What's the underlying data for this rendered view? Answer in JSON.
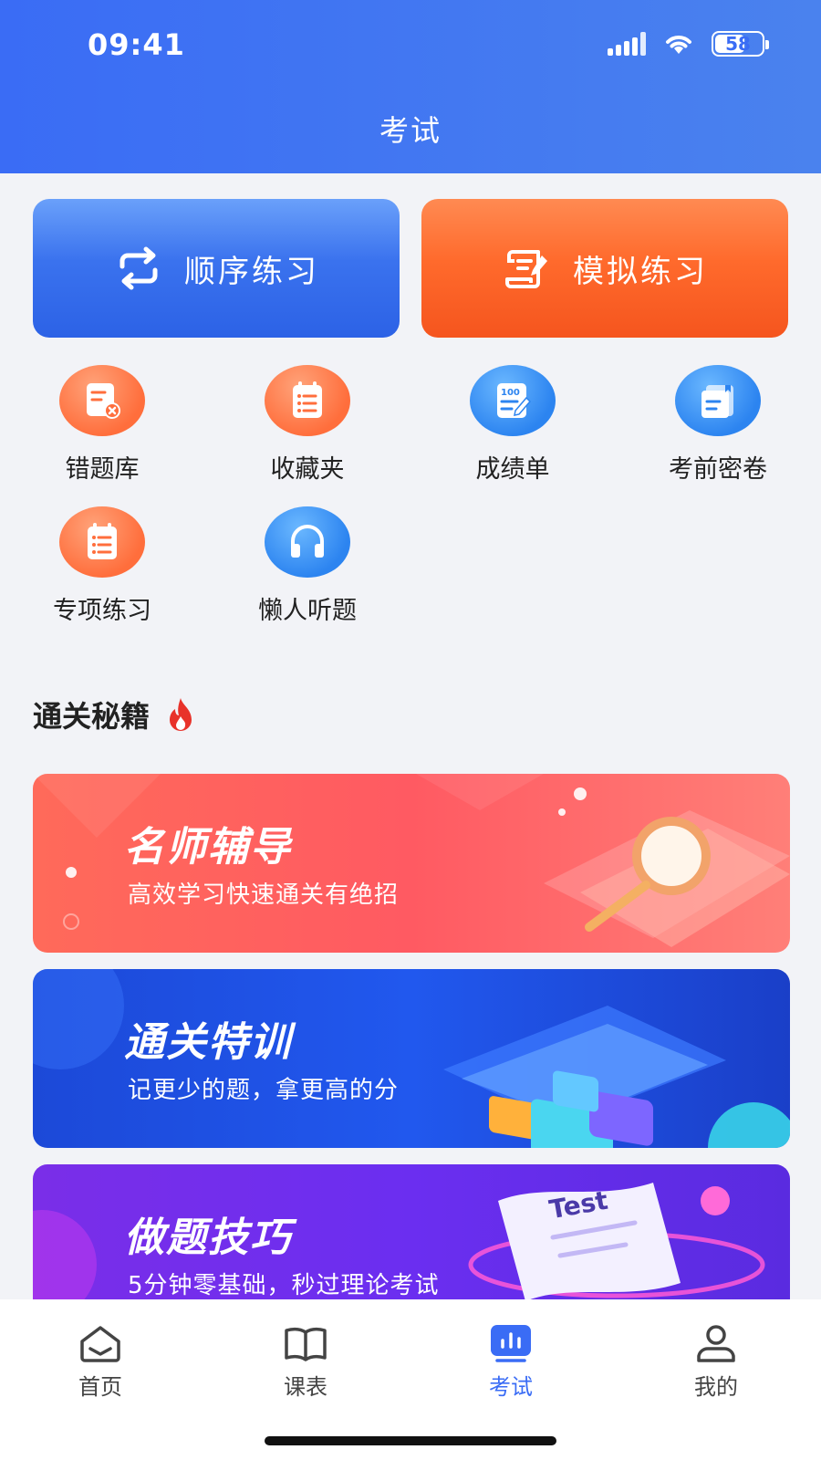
{
  "status": {
    "time": "09:41",
    "battery": "58"
  },
  "header": {
    "title": "考试"
  },
  "actions": {
    "sequential_label": "顺序练习",
    "mock_label": "模拟练习"
  },
  "grid": {
    "items": [
      {
        "label": "错题库",
        "icon": "wrong-questions-icon",
        "color": "#ff6e3c"
      },
      {
        "label": "收藏夹",
        "icon": "favorites-icon",
        "color": "#ff6e3c"
      },
      {
        "label": "成绩单",
        "icon": "score-report-icon",
        "color": "#2c84f0"
      },
      {
        "label": "考前密卷",
        "icon": "secret-paper-icon",
        "color": "#2c84f0"
      },
      {
        "label": "专项练习",
        "icon": "special-practice-icon",
        "color": "#ff6e3c"
      },
      {
        "label": "懒人听题",
        "icon": "headphones-icon",
        "color": "#2c84f0"
      }
    ]
  },
  "section": {
    "title": "通关秘籍",
    "icon": "fire-icon"
  },
  "banners": [
    {
      "title": "名师辅导",
      "subtitle": "高效学习快速通关有绝招",
      "color": "#ff6a5a"
    },
    {
      "title": "通关特训",
      "subtitle": "记更少的题，拿更高的分",
      "color": "#2158ee"
    },
    {
      "title": "做题技巧",
      "subtitle": "5分钟零基础，秒过理论考试",
      "badge": "Test",
      "color": "#6b2ef0"
    }
  ],
  "tabbar": {
    "items": [
      {
        "label": "首页",
        "icon": "home-icon"
      },
      {
        "label": "课表",
        "icon": "book-icon"
      },
      {
        "label": "考试",
        "icon": "exam-chart-icon",
        "active": true
      },
      {
        "label": "我的",
        "icon": "profile-icon"
      }
    ],
    "active_color": "#3a6cf5"
  }
}
